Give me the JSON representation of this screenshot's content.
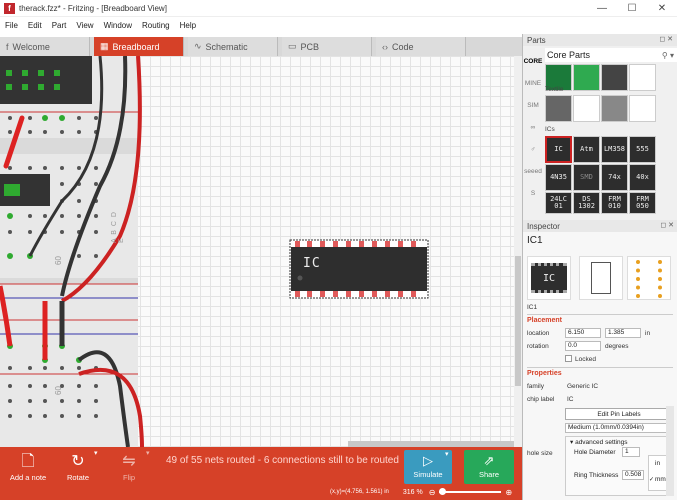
{
  "window": {
    "title": "therack.fzz* - Fritzing - [Breadboard View]",
    "minimize": "—",
    "maximize": "☐",
    "close": "✕"
  },
  "menu": [
    "File",
    "Edit",
    "Part",
    "View",
    "Window",
    "Routing",
    "Help"
  ],
  "tabs": [
    {
      "label": "Welcome",
      "icon": "f",
      "active": false
    },
    {
      "label": "Breadboard",
      "icon": "▦",
      "active": true
    },
    {
      "label": "Schematic",
      "icon": "∿",
      "active": false
    },
    {
      "label": "PCB",
      "icon": "▭",
      "active": false
    },
    {
      "label": "Code",
      "icon": "‹›",
      "active": false
    }
  ],
  "canvas": {
    "part_label": "IC",
    "breadboard_row_label": "60",
    "breadboard_letters": "A B C D E"
  },
  "bottom": {
    "add_note": "Add a note",
    "rotate": "Rotate",
    "flip": "Flip",
    "routing_status": "49 of 55 nets routed - 6 connections still to be routed",
    "simulate": "Simulate",
    "share": "Share",
    "coords": "(x,y)=(4.756, 1.561) in",
    "zoom": "316 %"
  },
  "parts": {
    "panel_title": "Parts",
    "bin_title": "Core Parts",
    "section_textile": "Textile",
    "section_ics": "ICs",
    "sidebar": [
      "CORE",
      "MINE",
      "SIM",
      "∞",
      "♂",
      "seeed",
      "☗",
      "S",
      "↓"
    ],
    "ic_tiles": [
      "IC",
      "Atm",
      "LM358",
      "555",
      "4N35",
      "SMD",
      "74x",
      "40x",
      "24LC 01",
      "DS 1302",
      "FRM 010",
      "FRM 050"
    ]
  },
  "inspector": {
    "panel_title": "Inspector",
    "part_name": "IC1",
    "title_below": "IC1",
    "placement": "Placement",
    "location_label": "location",
    "location_x": "6.150",
    "location_y": "1.385",
    "location_unit": "in",
    "rotation_label": "rotation",
    "rotation_value": "0.0",
    "rotation_unit": "degrees",
    "locked": "Locked",
    "properties": "Properties",
    "family_label": "family",
    "family_value": "Generic IC",
    "chip_label": "chip label",
    "chip_value": "IC",
    "edit_pin": "Edit Pin Labels",
    "hole_size": "hole size",
    "hole_option": "Medium (1.0mm/0.0394in)",
    "advanced": "advanced settings",
    "hole_diameter": "Hole Diameter",
    "hole_diameter_value": "1",
    "ring_thickness": "Ring Thickness",
    "ring_value": "0.508",
    "unit_in": "in",
    "unit_mm": "mm"
  },
  "colors": {
    "accent": "#d64128",
    "simulate": "#3a9bbf",
    "share": "#27a85a"
  }
}
